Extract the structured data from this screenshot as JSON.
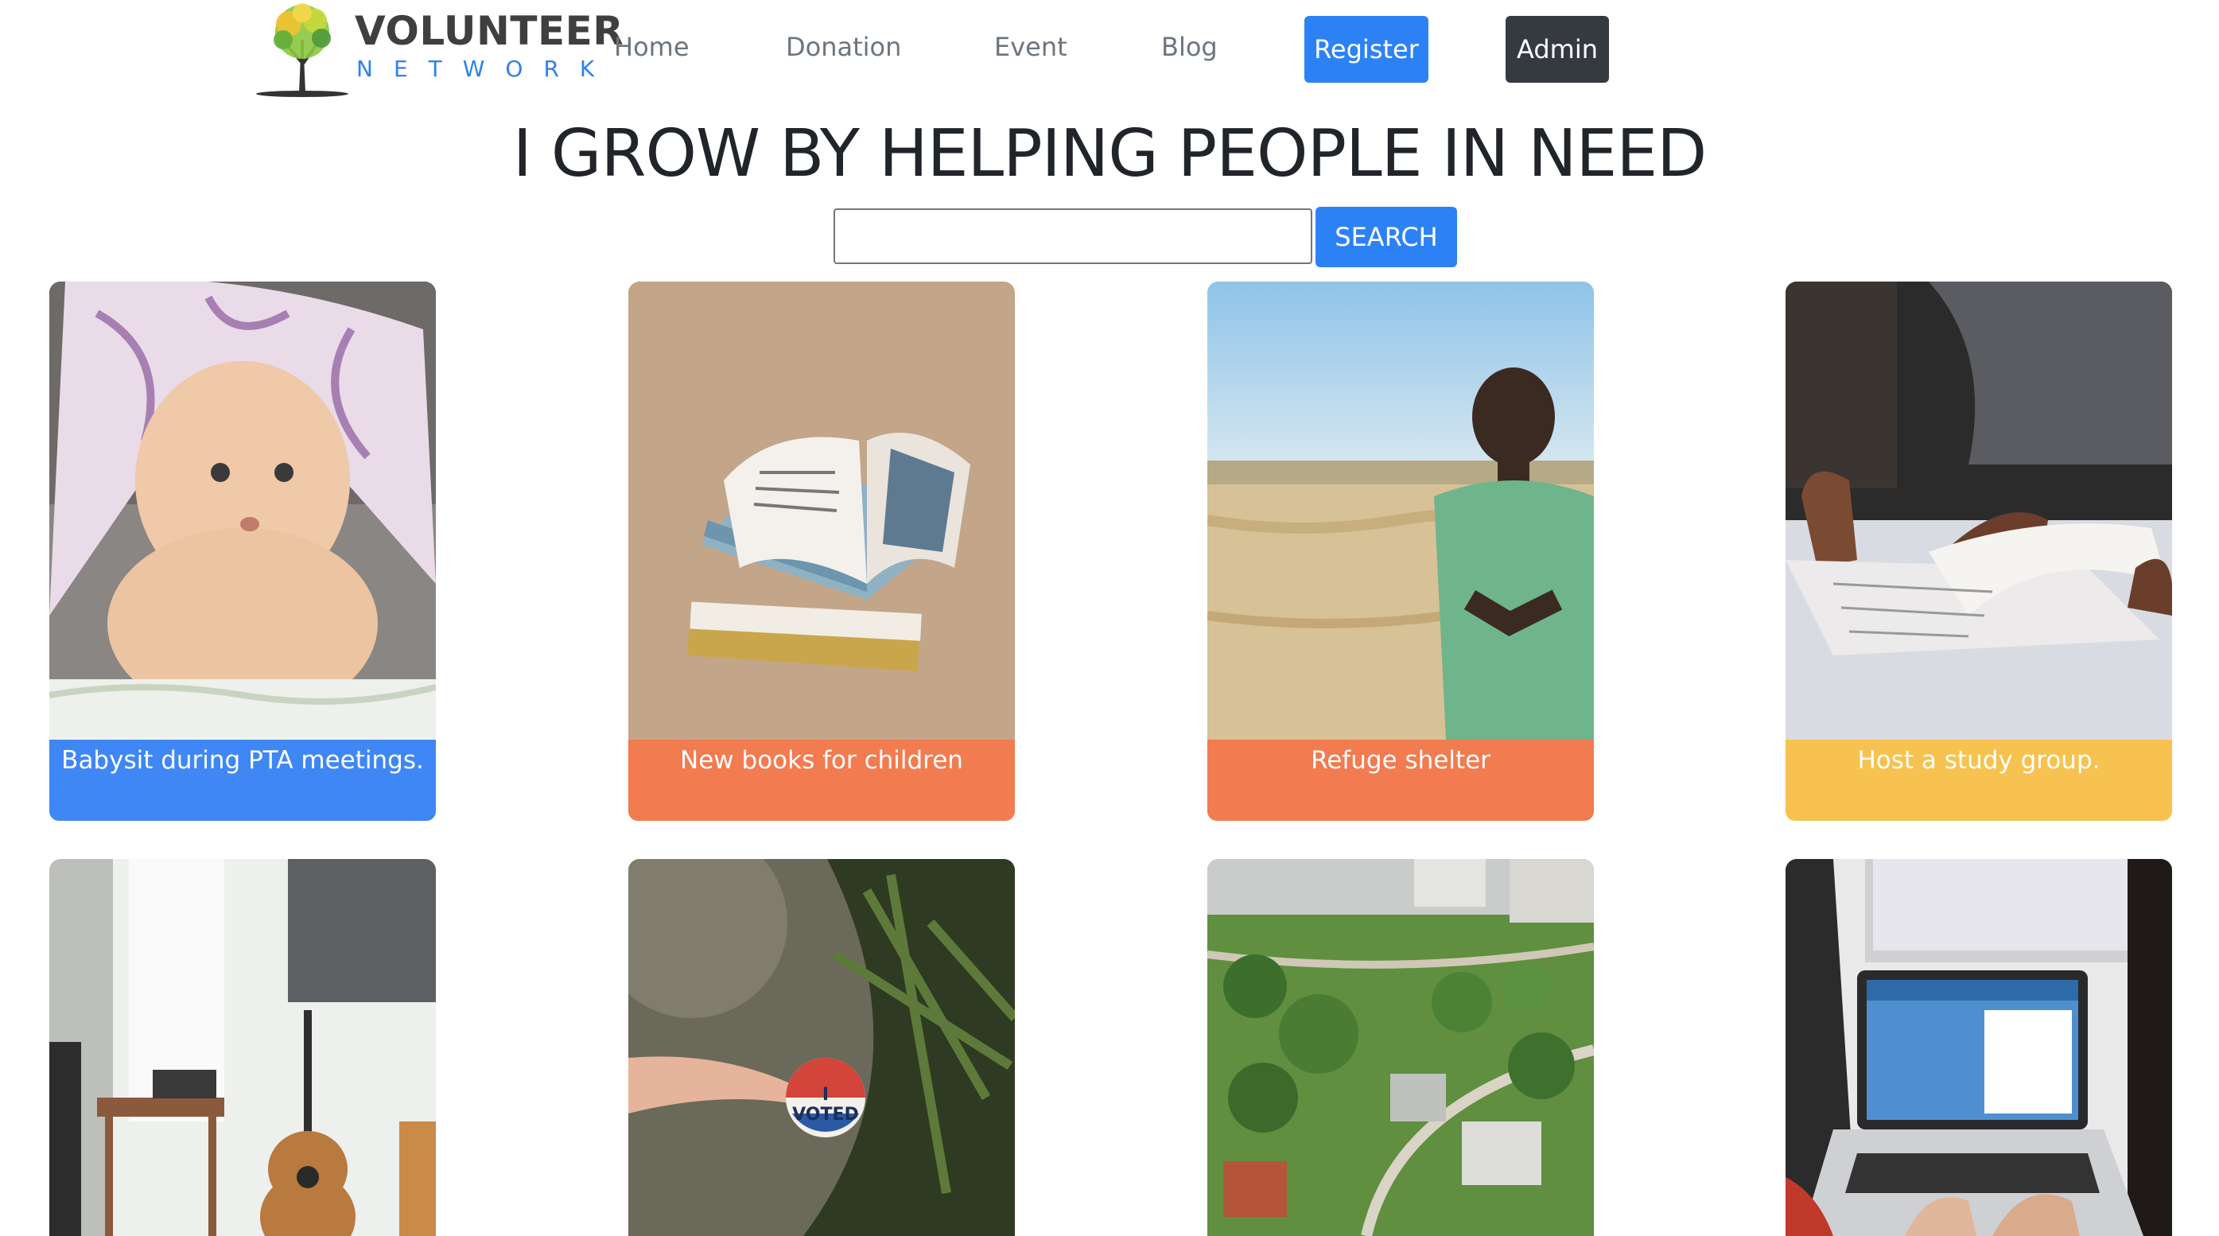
{
  "brand": {
    "title": "VOLUNTEER",
    "subtitle": "NETWORK"
  },
  "nav": {
    "items": [
      "Home",
      "Donation",
      "Event",
      "Blog"
    ],
    "register": "Register",
    "admin": "Admin"
  },
  "hero": {
    "title": "I GROW BY HELPING PEOPLE IN NEED"
  },
  "search": {
    "value": "",
    "placeholder": "",
    "button": "SEARCH"
  },
  "colors": {
    "blue": "#3f87f5",
    "orange": "#f27b50",
    "yellow": "#f7c24f",
    "dark": "#343a40"
  },
  "cards": [
    {
      "label": "Babysit during PTA meetings.",
      "color": "#3f87f5",
      "image": "baby-photo"
    },
    {
      "label": "New books for children",
      "color": "#f27b50",
      "image": "books-photo"
    },
    {
      "label": "Refuge shelter",
      "color": "#f27b50",
      "image": "child-field-photo"
    },
    {
      "label": "Host a study group.",
      "color": "#f7c24f",
      "image": "study-photo"
    },
    {
      "label": "",
      "color": "",
      "image": "guitar-room-photo"
    },
    {
      "label": "",
      "color": "",
      "image": "voted-sticker-photo"
    },
    {
      "label": "",
      "color": "",
      "image": "park-aerial-photo"
    },
    {
      "label": "",
      "color": "",
      "image": "laptop-photo"
    }
  ],
  "sticker": {
    "text": "I VOTED"
  }
}
